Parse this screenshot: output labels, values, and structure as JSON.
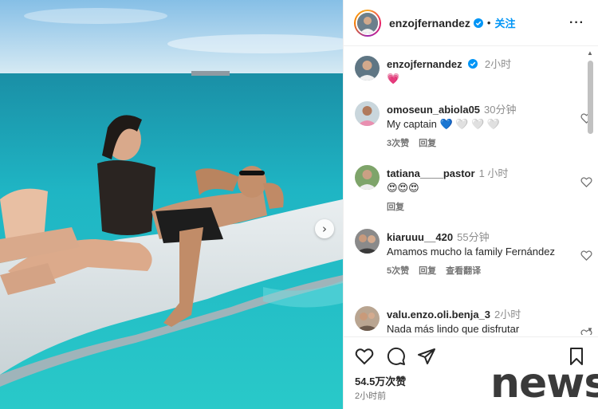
{
  "post": {
    "author": "enzojfernandez",
    "follow_label": "关注",
    "more_label": "···",
    "caption_time": "2小时",
    "caption_emoji": "💗"
  },
  "comments": [
    {
      "username": "omoseun_abiola05",
      "time": "30分钟",
      "text": "My captain 💙 🤍 🤍 🤍",
      "likes": "3次赞",
      "reply": "回复"
    },
    {
      "username": "tatiana____pastor",
      "time": "1 小时",
      "text": "😍😍😍",
      "reply": "回复"
    },
    {
      "username": "kiaruuu__420",
      "time": "55分钟",
      "text": "Amamos mucho la family Fernández",
      "likes": "5次赞",
      "reply": "回复",
      "translate": "查看翻译"
    },
    {
      "username": "valu.enzo.oli.benja_3",
      "time": "2小时",
      "text": "Nada más lindo que disfrutar"
    }
  ],
  "footer": {
    "likes_count": "54.5万次赞",
    "posted_ago": "2小时前"
  },
  "watermark": "news",
  "colors": {
    "link": "#0095f6",
    "muted": "#737373",
    "verified": "#0095f6",
    "sea": "#1fb5c4"
  },
  "icons": [
    "verified-badge-icon",
    "more-options-icon",
    "heart-icon",
    "comment-icon",
    "share-icon",
    "bookmark-icon",
    "chevron-right-icon"
  ]
}
